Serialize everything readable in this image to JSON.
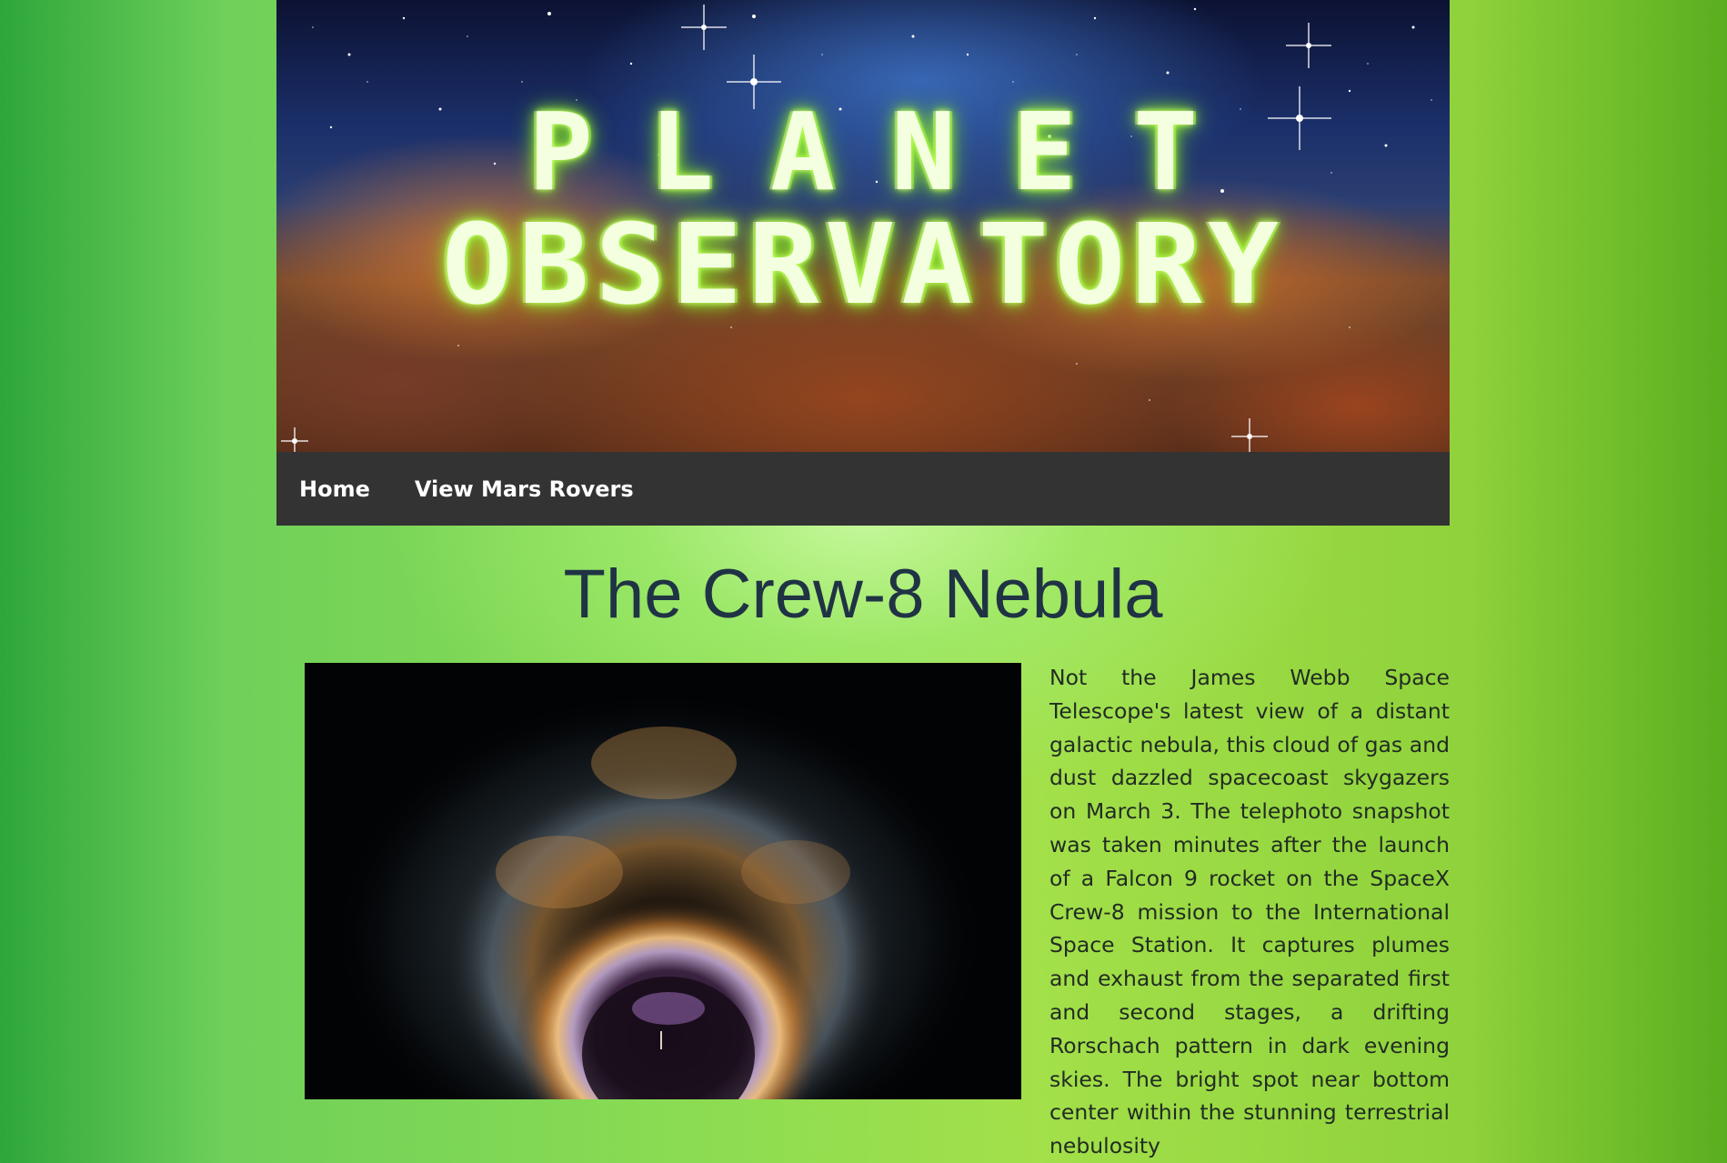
{
  "banner": {
    "title_line1": "PLANET",
    "title_line2": "OBSERVATORY"
  },
  "nav": {
    "items": [
      {
        "label": "Home"
      },
      {
        "label": "View Mars Rovers"
      }
    ]
  },
  "main": {
    "heading": "The Crew-8 Nebula",
    "description": "Not the James Webb Space Telescope's latest view of a distant galactic nebula, this cloud of gas and dust dazzled spacecoast skygazers on March 3. The telephoto snapshot was taken minutes after the launch of a Falcon 9 rocket on the SpaceX Crew-8 mission to the International Space Station. It captures plumes and exhaust from the separated first and second stages, a drifting Rorschach pattern in dark evening skies. The bright spot near bottom center within the stunning terrestrial nebulosity"
  },
  "colors": {
    "nav_background": "#333333",
    "heading": "#1f3344",
    "title_glow": "#9cf23a"
  }
}
